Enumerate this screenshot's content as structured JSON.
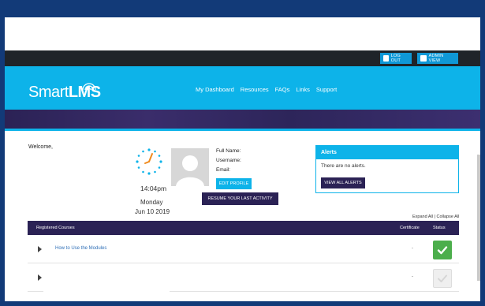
{
  "topbar": {
    "logout_label": "LOG OUT",
    "admin_label": "ADMIN VIEW"
  },
  "brand": {
    "name_light": "Smart",
    "name_bold": "LMS"
  },
  "nav": [
    {
      "label": "My Dashboard"
    },
    {
      "label": "Resources"
    },
    {
      "label": "FAQs"
    },
    {
      "label": "Links"
    },
    {
      "label": "Support"
    }
  ],
  "welcome": "Welcome,",
  "clock": {
    "time": "14:04pm",
    "day": "Monday",
    "date": "Jun 10 2019"
  },
  "profile": {
    "full_name_label": "Full Name:",
    "username_label": "Username:",
    "email_label": "Email:",
    "edit_label": "EDIT PROFILE",
    "resume_label": "RESUME YOUR LAST ACTIVITY"
  },
  "alerts": {
    "title": "Alerts",
    "message": "There are no alerts.",
    "button": "VIEW ALL ALERTS"
  },
  "expand_collapse": "Expand All | Collapse All",
  "table": {
    "col_courses": "Registered Courses",
    "col_certificate": "Certificate",
    "col_status": "Status",
    "rows": [
      {
        "course": "How to Use the Modules",
        "certificate": "-",
        "status": "complete"
      },
      {
        "course": "",
        "certificate": "-",
        "status": "incomplete"
      }
    ]
  },
  "colors": {
    "accent": "#0db3e9",
    "dark": "#2b2255",
    "success": "#4cae4c"
  }
}
